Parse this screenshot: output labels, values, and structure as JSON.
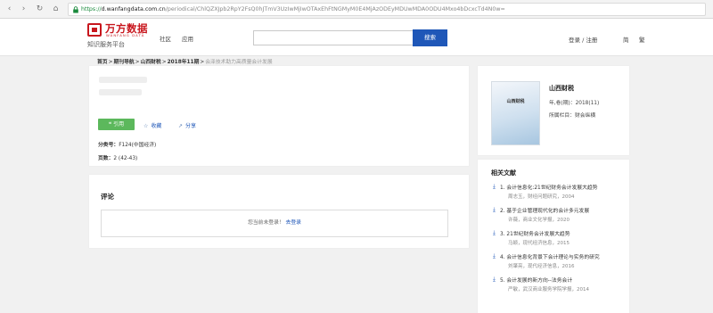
{
  "browser": {
    "back": "‹",
    "forward": "›",
    "reload": "↻",
    "home": "⌂",
    "url_proto": "https://",
    "url_host": "d.wanfangdata.com.cn",
    "url_path": "/periodical/ChlQZXJpb2RpY2FsQ0hJTmV3UzIwMjIwOTAxEhFtNGMyM0E4MjAzODEyMDUwMDA0ODU4Mxo4bDcxcTd4N0w="
  },
  "header": {
    "logo_cn": "万方数据",
    "logo_en": "WANFANG DATA",
    "logo_sub": "知识服务平台",
    "nav": [
      "社区",
      "应用"
    ],
    "search_value": "",
    "search_button": "搜索",
    "login": "登录 / 注册",
    "extra": [
      "简",
      "繁"
    ]
  },
  "breadcrumb": {
    "items": [
      "首页",
      "期刊导航",
      "山西财税",
      "2018年11期"
    ],
    "current": "会泽技术助力高质量会计发展"
  },
  "article": {
    "cite_button": "引用",
    "collect": "收藏",
    "share": "分享",
    "class_label": "分类号：",
    "class_value": "F124(中国经济)",
    "pages_label": "页数：",
    "pages_value": "2 (42-43)"
  },
  "comments": {
    "title": "评论",
    "prompt": "您当前未登录！",
    "login_link": "去登录"
  },
  "journal": {
    "cover_title": "山西财税",
    "name": "山西财税",
    "issue_label": "年,卷(期)：",
    "issue_value": "2018(11)",
    "column_label": "所属栏目：",
    "column_value": "财会纵横"
  },
  "related": {
    "title": "相关文献",
    "items": [
      {
        "index": "1.",
        "title": "会计信息化:21世纪财务会计发展大趋势",
        "sub": "周志玉，财经问题研究，2004"
      },
      {
        "index": "2.",
        "title": "基于企业管理现代化的会计多元发展",
        "sub": "许薇，商业文化学报，2020"
      },
      {
        "index": "3.",
        "title": "21世纪财务会计发展大趋势",
        "sub": "马颖，现代经济信息，2015"
      },
      {
        "index": "4.",
        "title": "会计信息化背景下会计理论与实务的研究",
        "sub": "刘肇亮，现代经济信息，2016"
      },
      {
        "index": "5.",
        "title": "会计发展的新方向--法务会计",
        "sub": "严敏，武汉商业服务学院学报，2014"
      }
    ]
  },
  "colors": {
    "brand_red": "#c8161d",
    "accent_blue": "#1f57b8",
    "cite_green": "#5cb85c"
  }
}
